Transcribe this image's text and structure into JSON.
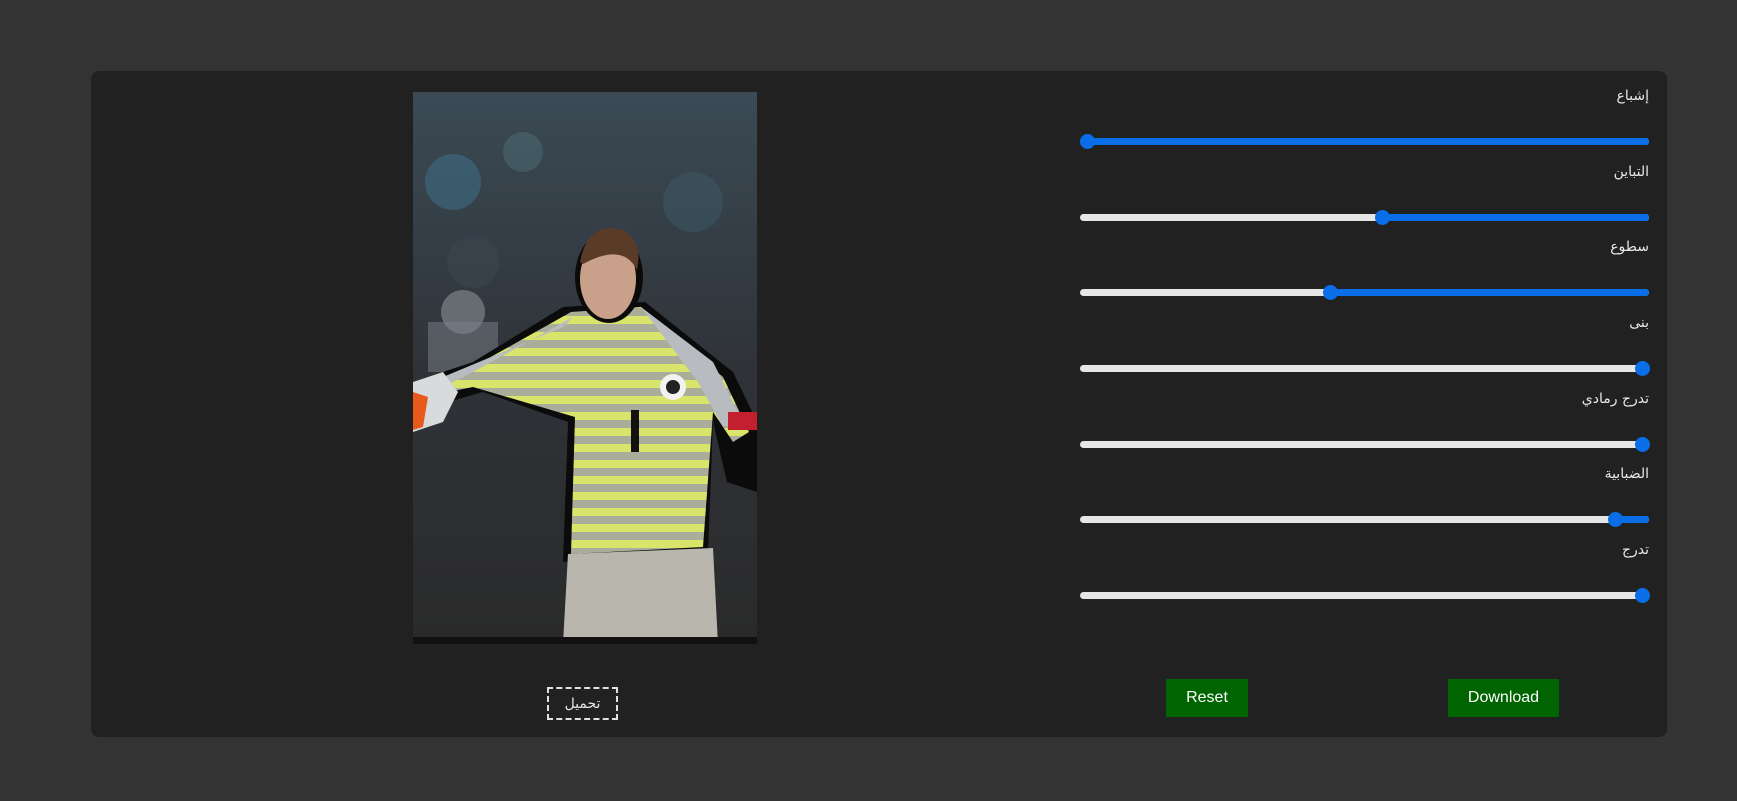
{
  "editor": {
    "sliders": [
      {
        "label": "إشباع",
        "value": 0
      },
      {
        "label": "التباين",
        "value": 0.53
      },
      {
        "label": "سطوع",
        "value": 0.44
      },
      {
        "label": "بنى",
        "value": 1
      },
      {
        "label": "تدرج رمادي",
        "value": 1
      },
      {
        "label": "الضبابية",
        "value": 0.94
      },
      {
        "label": "تدرج",
        "value": 1
      }
    ],
    "upload_label": "تحميل",
    "reset_label": "Reset",
    "download_label": "Download",
    "preview_image": "goalkeeper-photo",
    "colors": {
      "accent": "#0a6ee8",
      "button": "#006400",
      "panel": "#212121",
      "page": "#333333"
    }
  }
}
